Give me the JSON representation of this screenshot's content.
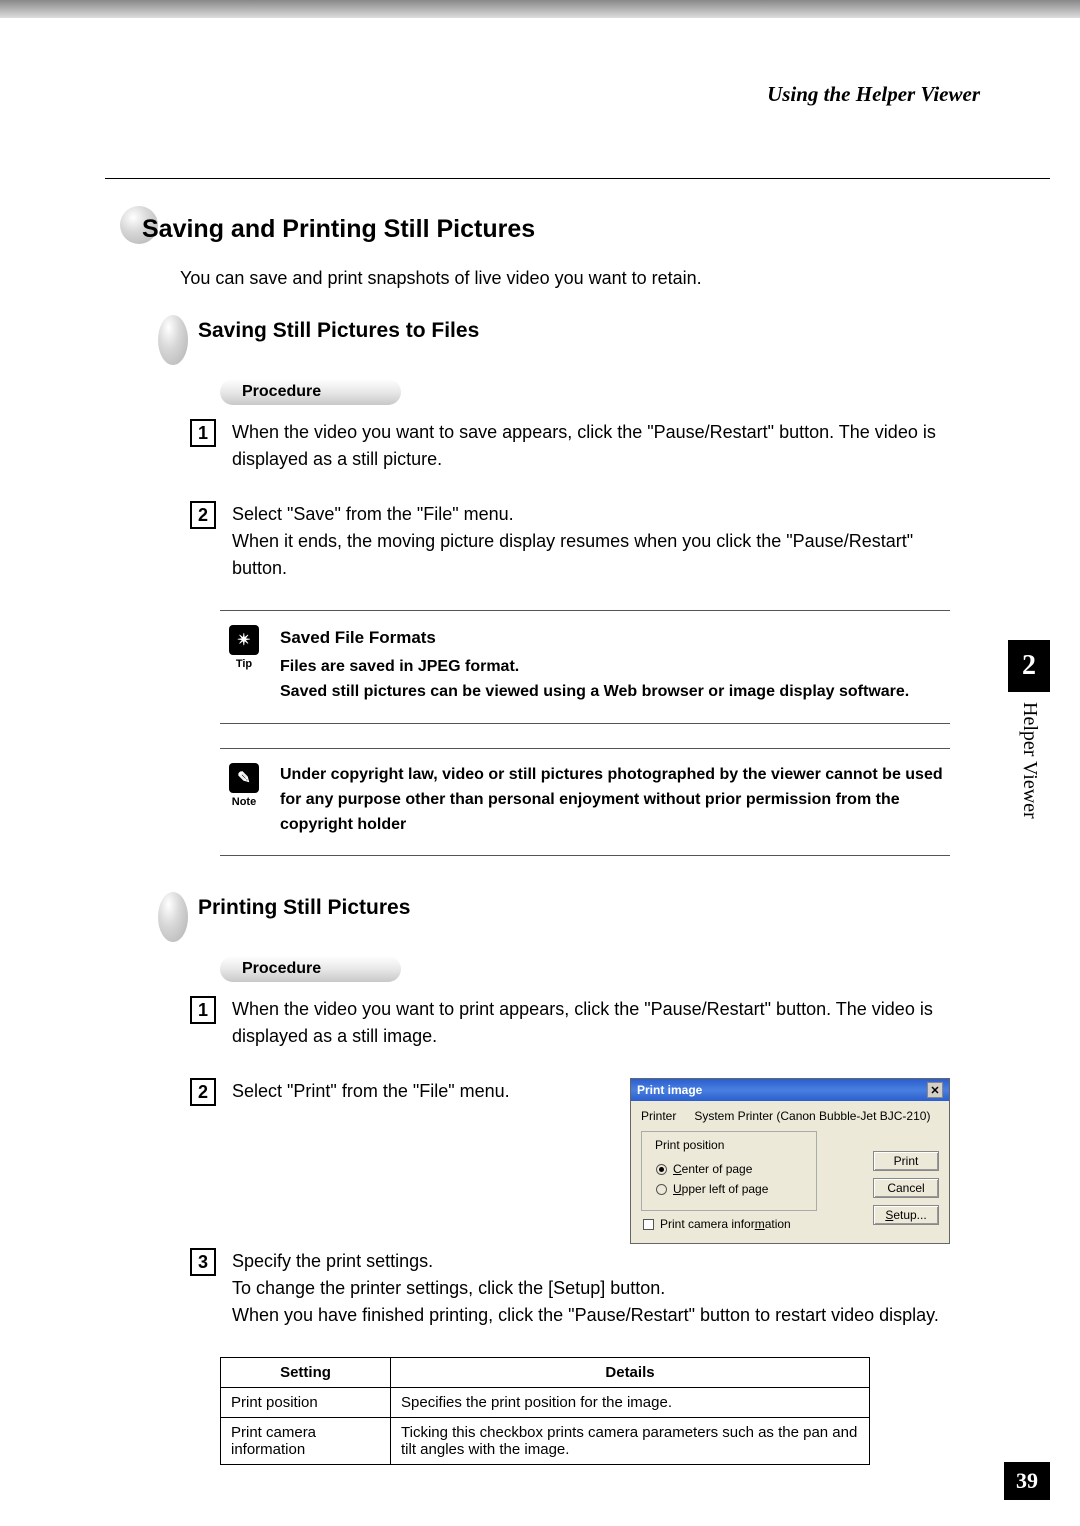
{
  "header": {
    "running_head": "Using the Helper Viewer"
  },
  "chapter_tab": {
    "number": "2",
    "label": "Helper Viewer"
  },
  "page_number": "39",
  "section": {
    "title": "Saving and Printing Still Pictures",
    "intro": "You can save and print snapshots of live video you want to retain."
  },
  "saving": {
    "title": "Saving Still Pictures to Files",
    "procedure_label": "Procedure",
    "steps": [
      {
        "num": "1",
        "text": "When the video you want to save appears, click the \"Pause/Restart\" button. The video is displayed as a still picture."
      },
      {
        "num": "2",
        "text": "Select \"Save\" from the \"File\" menu.\nWhen it ends, the moving picture display resumes when you click the \"Pause/Restart\" button."
      }
    ],
    "tip": {
      "label": "Tip",
      "title": "Saved File Formats",
      "line1": "Files are saved in JPEG format.",
      "line2": "Saved still pictures can be viewed using a Web browser or image display software."
    },
    "note": {
      "label": "Note",
      "text": "Under copyright law, video or still pictures photographed by the viewer cannot be used for any purpose other than personal enjoyment without prior permission from the copyright holder"
    }
  },
  "printing": {
    "title": "Printing Still Pictures",
    "procedure_label": "Procedure",
    "steps": [
      {
        "num": "1",
        "text": "When the video you want to print appears, click the \"Pause/Restart\" button. The video is displayed as a still image."
      },
      {
        "num": "2",
        "text": "Select \"Print\" from the \"File\" menu."
      },
      {
        "num": "3",
        "text": "Specify the print settings.\nTo change the printer settings, click the [Setup] button.\nWhen you have finished printing, click the \"Pause/Restart\" button to restart video display."
      }
    ],
    "dialog": {
      "title": "Print image",
      "printer_label": "Printer",
      "printer_value": "System Printer (Canon Bubble-Jet BJC-210)",
      "group_title": "Print position",
      "option_center": "Center of page",
      "option_upperleft": "Upper left of page",
      "selected_option": "center",
      "checkbox_label": "Print camera information",
      "checkbox_checked": false,
      "buttons": {
        "print": "Print",
        "cancel": "Cancel",
        "setup": "Setup..."
      }
    },
    "table": {
      "headers": [
        "Setting",
        "Details"
      ],
      "rows": [
        {
          "setting": "Print position",
          "details": "Specifies the print position for the image."
        },
        {
          "setting": "Print camera information",
          "details": "Ticking this checkbox prints camera parameters such as the pan and tilt angles with the image."
        }
      ]
    }
  }
}
